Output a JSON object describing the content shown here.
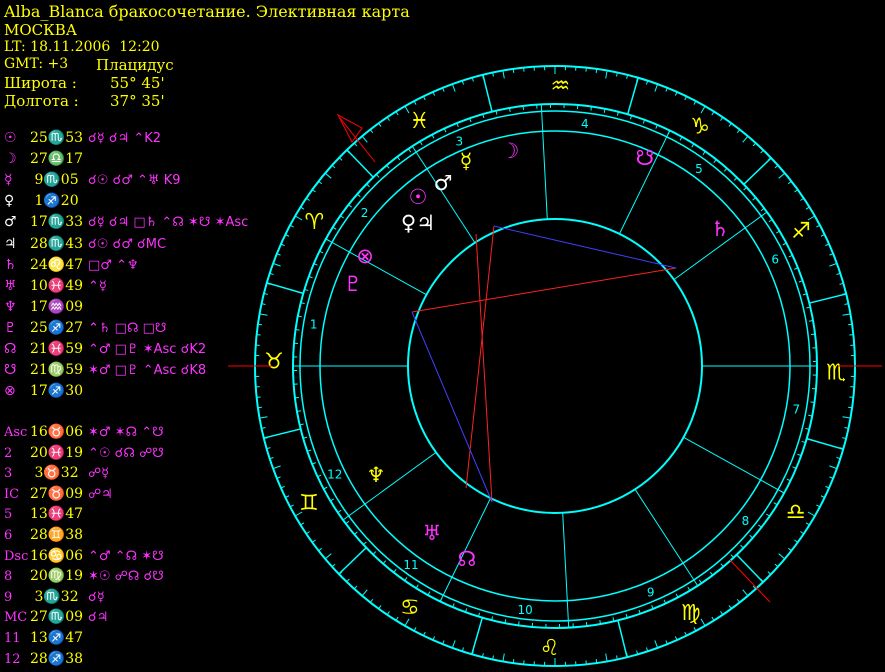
{
  "header": {
    "title": "Alba_Blanca бракосочетание. Элективная карта",
    "city": "МОСКВА",
    "local_time": "LT: 18.11.2006  12:20",
    "gmt": "GMT: +3",
    "house_system": "Плацидус",
    "latitude_label": "Широта :",
    "latitude_value": "55° 45'",
    "longitude_label": "Долгота :",
    "longitude_value": "37° 35'"
  },
  "colors": {
    "background": "#000000",
    "header": "#ffff00",
    "wheel": "#00ffff",
    "planet_symbol": "#ff33ff",
    "asc_line": "#ff0000",
    "aspect_blue": "#4040ff"
  },
  "planets": [
    {
      "symbol": "☉",
      "pos": "25♏53",
      "aspects": "☌☿ ☌♃ ⌃K2",
      "color": "#ff33ff"
    },
    {
      "symbol": "☽",
      "pos": "27♎17",
      "aspects": "",
      "color": "#ff33ff"
    },
    {
      "symbol": "☿",
      "pos": " 9♏05",
      "aspects": "☌☉ ☌♂ ⌃♅ K9",
      "color": "#ff33ff"
    },
    {
      "symbol": "♀",
      "pos": " 1♐20",
      "aspects": "",
      "color": "#ffffff"
    },
    {
      "symbol": "♂",
      "pos": "17♏33",
      "aspects": "☌☿ ☌♃ □♄ ⌃☊ ✶☋ ✶Asc",
      "color": "#ffffff"
    },
    {
      "symbol": "♃",
      "pos": "28♏43",
      "aspects": "☌☉ ☌♂ ☌MC",
      "color": "#ffffff"
    },
    {
      "symbol": "♄",
      "pos": "24♌47",
      "aspects": "□♂ ⌃♆",
      "color": "#ff33ff"
    },
    {
      "symbol": "♅",
      "pos": "10♓49",
      "aspects": "⌃☿",
      "color": "#ff33ff"
    },
    {
      "symbol": "♆",
      "pos": "17♒09",
      "aspects": "",
      "color": "#ff33ff"
    },
    {
      "symbol": "♇",
      "pos": "25♐27",
      "aspects": "⌃♄ □☊ □☋",
      "color": "#ff33ff"
    },
    {
      "symbol": "☊",
      "pos": "21♓59",
      "aspects": "⌃♂ □♇ ✶Asc ☌K2",
      "color": "#ff33ff"
    },
    {
      "symbol": "☋",
      "pos": "21♍59",
      "aspects": "✶♂ □♇ ⌃Asc ☌K8",
      "color": "#ff33ff"
    },
    {
      "symbol": "⊗",
      "pos": "17♐30",
      "aspects": "",
      "color": "#ff33ff"
    }
  ],
  "cusps": [
    {
      "label": "Asc",
      "pos": "16♉06",
      "aspects": "✶♂ ✶☊ ⌃☋"
    },
    {
      "label": "2",
      "pos": "20♓19",
      "aspects": "⌃☉ ☌☊ ☍☋"
    },
    {
      "label": "3",
      "pos": " 3♉32",
      "aspects": "☍☿"
    },
    {
      "label": "IC",
      "pos": "27♉09",
      "aspects": "☍♃"
    },
    {
      "label": "5",
      "pos": "13♓47",
      "aspects": ""
    },
    {
      "label": "6",
      "pos": "28♊38",
      "aspects": ""
    },
    {
      "label": "Dsc",
      "pos": "16♋06",
      "aspects": "⌃♂ ⌃☊ ✶☋"
    },
    {
      "label": "8",
      "pos": "20♍19",
      "aspects": "✶☉ ☍☊ ☌☋"
    },
    {
      "label": "9",
      "pos": " 3♏32",
      "aspects": "☌☿"
    },
    {
      "label": "MC",
      "pos": "27♏09",
      "aspects": "☌♃"
    },
    {
      "label": "11",
      "pos": "13♐47",
      "aspects": ""
    },
    {
      "label": "12",
      "pos": "28♐38",
      "aspects": ""
    }
  ],
  "wheel": {
    "house_numbers": [
      "1",
      "2",
      "3",
      "4",
      "5",
      "6",
      "7",
      "8",
      "9",
      "10",
      "11",
      "12"
    ],
    "zodiac_ring": [
      "♒",
      "♓",
      "♈",
      "♉",
      "♊",
      "♋",
      "♌",
      "♍",
      "♎",
      "♏",
      "♐",
      "♑"
    ],
    "chart_planets": [
      "☽",
      "☿",
      "♂",
      "☉",
      "♀♃",
      "⊗",
      "♇",
      "♄",
      "♆",
      "♅",
      "☊",
      "☋"
    ]
  }
}
